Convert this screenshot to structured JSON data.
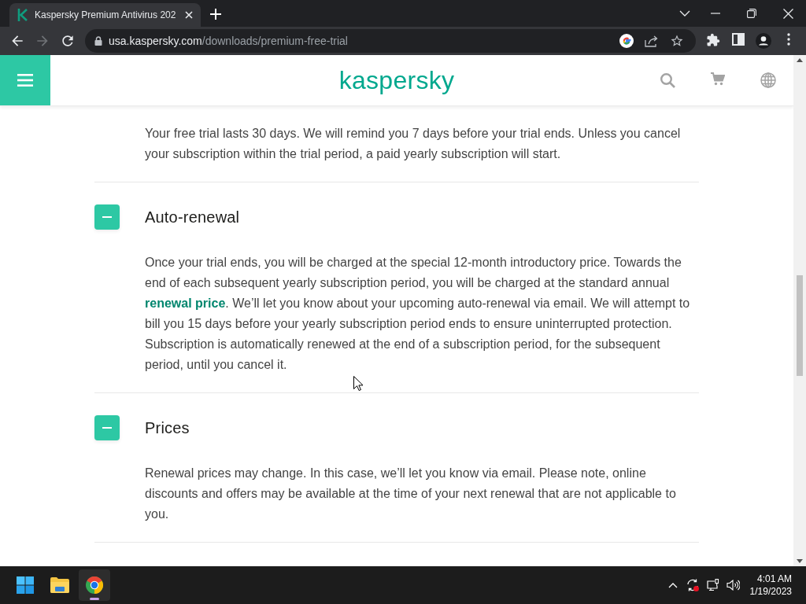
{
  "browser": {
    "tab": {
      "title": "Kaspersky Premium Antivirus 202",
      "selected": true
    },
    "nav": [
      {
        "kind": "back",
        "disabled": false
      },
      {
        "kind": "forward",
        "disabled": true
      },
      {
        "kind": "reload",
        "disabled": false
      }
    ],
    "url": {
      "host": "usa.kaspersky.com",
      "path": "/downloads/premium-free-trial"
    }
  },
  "site_header": {
    "logo": "kaspersky"
  },
  "intro": "Your free trial lasts 30 days. We will remind you 7 days before your trial ends. Unless you cancel your subscription within the trial period, a paid yearly subscription will start.",
  "sections": [
    {
      "heading": "Auto-renewal",
      "expanded": true,
      "body": [
        {
          "kind": "text",
          "text": "Once your trial ends, you will be charged at the special 12-month introductory price. Towards the end of each subsequent yearly subscription period, you will be charged at the standard annual "
        },
        {
          "kind": "link",
          "text": "renewal price"
        },
        {
          "kind": "text",
          "text": ". We’ll let you know about your upcoming auto-renewal via email. We will attempt to bill you 15 days before your yearly subscription period ends to ensure uninterrupted protection. Subscription is automatically renewed at the end of a subscription period, for the subsequent period, until you cancel it."
        }
      ]
    },
    {
      "heading": "Prices",
      "expanded": true,
      "body": [
        {
          "kind": "text",
          "text": "Renewal prices may change. In this case, we’ll let you know via email. Please note, online discounts and offers may be available at the time of your next renewal that are not applicable to you."
        }
      ]
    }
  ],
  "taskbar": {
    "apps": [
      {
        "kind": "start",
        "selected": false
      },
      {
        "kind": "explorer",
        "selected": false
      },
      {
        "kind": "browser",
        "selected": true
      }
    ],
    "clock": {
      "time": "4:01 AM",
      "date": "1/19/2023"
    }
  }
}
